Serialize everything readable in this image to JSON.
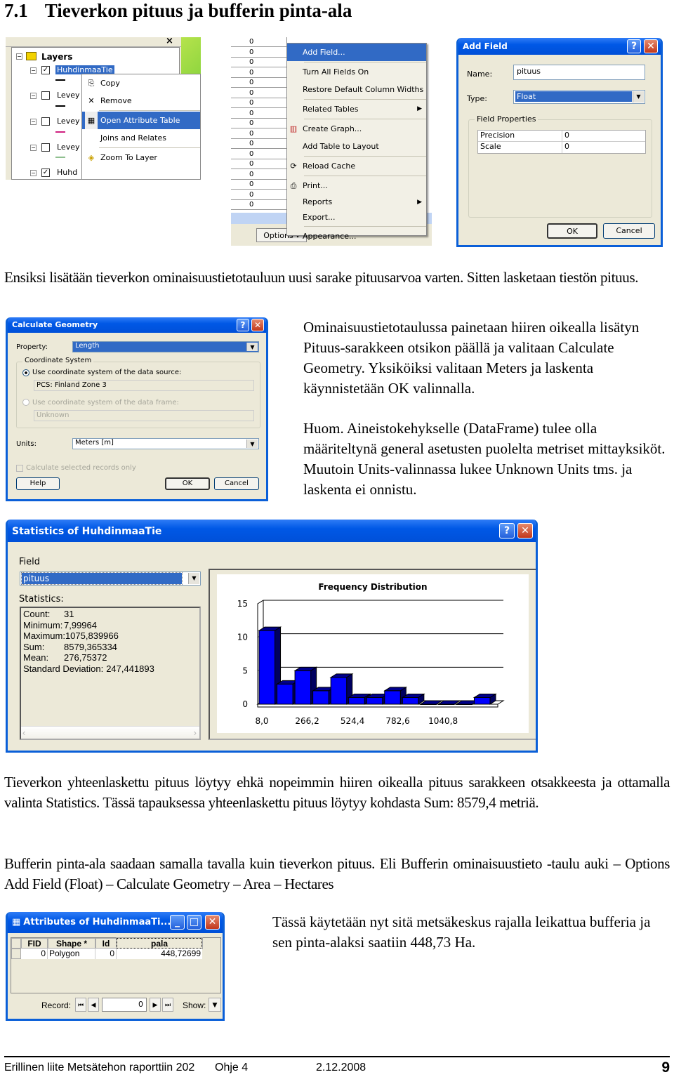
{
  "heading": {
    "number": "7.1",
    "title": "Tieverkon pituus ja bufferin pinta-ala"
  },
  "screenshot1_toc": {
    "close_label": "×",
    "root": "Layers",
    "layers": [
      {
        "name": "HuhdinmaaTie",
        "checked": true,
        "selected": true
      },
      {
        "name": "Levey",
        "checked": false
      },
      {
        "name": "Levey",
        "checked": false
      },
      {
        "name": "Levey",
        "checked": false
      },
      {
        "name": "Huhd",
        "checked": true
      }
    ],
    "context_menu": [
      {
        "label": "Copy",
        "icon": "copy-icon"
      },
      {
        "label": "Remove",
        "icon": "remove-icon"
      },
      {
        "label": "Open Attribute Table",
        "icon": "table-icon",
        "highlighted": true
      },
      {
        "label": "Joins and Relates"
      },
      {
        "label": "Zoom To Layer",
        "icon": "zoom-to-layer-icon"
      }
    ]
  },
  "screenshot2_table_menu": {
    "column_values": [
      "0",
      "0",
      "0",
      "0",
      "0",
      "0",
      "0",
      "0",
      "0",
      "0",
      "0",
      "0",
      "0",
      "0",
      "0",
      "0",
      "0"
    ],
    "options_label": "Options",
    "menu": [
      {
        "label": "Add Field...",
        "highlighted": true
      },
      {
        "label": "Turn All Fields On"
      },
      {
        "label": "Restore Default Column Widths"
      },
      {
        "label": "Related Tables",
        "submenu": true
      },
      {
        "label": "Create Graph...",
        "icon": "graph-icon"
      },
      {
        "label": "Add Table to Layout"
      },
      {
        "label": "Reload Cache",
        "icon": "reload-icon"
      },
      {
        "label": "Print...",
        "icon": "print-icon"
      },
      {
        "label": "Reports",
        "submenu": true
      },
      {
        "label": "Export..."
      },
      {
        "label": "Appearance..."
      }
    ]
  },
  "add_field_dialog": {
    "title": "Add Field",
    "name_label": "Name:",
    "name_value": "pituus",
    "type_label": "Type:",
    "type_value": "Float",
    "group_label": "Field Properties",
    "properties": [
      {
        "name": "Precision",
        "value": "0"
      },
      {
        "name": "Scale",
        "value": "0"
      }
    ],
    "ok_label": "OK",
    "cancel_label": "Cancel"
  },
  "paragraph1": "Ensiksi lisätään tieverkon ominaisuustietotauluun uusi sarake pituusarvoa varten. Sitten lasketaan tiestön pituus.",
  "calculate_geometry_dialog": {
    "title": "Calculate Geometry",
    "property_label": "Property:",
    "property_value": "Length",
    "coord_group_label": "Coordinate System",
    "radio1_label": "Use coordinate system of the data source:",
    "radio1_value": "PCS: Finland Zone 3",
    "radio2_label": "Use coordinate system of the data frame:",
    "radio2_value": "Unknown",
    "units_label": "Units:",
    "units_value": "Meters [m]",
    "checkbox_label": "Calculate selected records only",
    "help_label": "Help",
    "ok_label": "OK",
    "cancel_label": "Cancel"
  },
  "paragraph2": "Ominaisuustietotaulussa painetaan hiiren oikealla lisätyn Pituus-sarakkeen otsikon päällä ja valitaan Calculate Geometry. Yksiköiksi valitaan Meters ja laskenta käynnistetään OK valinnalla.",
  "paragraph3": "Huom. Aineistokehykselle (DataFrame) tulee olla määriteltynä general asetusten puolelta metriset mittayksiköt. Muutoin Units-valinnassa lukee Unknown Units tms. ja laskenta ei onnistu.",
  "statistics_dialog": {
    "title": "Statistics of HuhdinmaaTie",
    "field_label": "Field",
    "field_value": "pituus",
    "statistics_label": "Statistics:",
    "stats": [
      {
        "name": "Count:",
        "value": "31"
      },
      {
        "name": "Minimum:",
        "value": "7,99964"
      },
      {
        "name": "Maximum:",
        "value": "1075,839966"
      },
      {
        "name": "Sum:",
        "value": "8579,365334"
      },
      {
        "name": "Mean:",
        "value": "276,75372"
      },
      {
        "name": "Standard Deviation:",
        "value": "247,441893"
      }
    ]
  },
  "chart_data": {
    "type": "bar",
    "title": "Frequency Distribution",
    "xlabel": "",
    "ylabel": "",
    "ylim": [
      0,
      15
    ],
    "yticks": [
      "0",
      "5",
      "10",
      "15"
    ],
    "xticks": [
      "8,0",
      "266,2",
      "524,4",
      "782,6",
      "1040,8"
    ],
    "values": [
      11,
      3,
      5,
      2,
      4,
      1,
      1,
      2,
      1,
      0,
      0,
      0,
      1
    ],
    "grid": true,
    "bar_color": "#0000ff"
  },
  "paragraph4": "Tieverkon yhteenlaskettu pituus löytyy ehkä nopeimmin hiiren oikealla pituus sarakkeen otsakkeesta ja ottamalla valinta Statistics. Tässä tapauksessa yhteenlaskettu pituus löytyy kohdasta Sum: 8579,4 metriä.",
  "paragraph5": "Bufferin pinta-ala saadaan samalla tavalla kuin tieverkon pituus. Eli Bufferin ominaisuustieto -taulu auki – Options Add Field (Float) – Calculate Geometry – Area – Hectares",
  "attributes_window": {
    "title": "Attributes of HuhdinmaaTi...",
    "columns": [
      "FID",
      "Shape *",
      "Id",
      "pala"
    ],
    "rows": [
      [
        "0",
        "Polygon",
        "0",
        "448,72699"
      ]
    ],
    "record_label": "Record:",
    "record_value": "0",
    "show_label": "Show:"
  },
  "paragraph6": "Tässä käytetään nyt sitä metsäkeskus rajalla leikattua bufferia ja sen pinta-alaksi saatiin 448,73 Ha.",
  "footer": {
    "left": "Erillinen liite Metsätehon raporttiin 202",
    "doc": "Ohje 4",
    "date": "2.12.2008",
    "page": "9"
  }
}
